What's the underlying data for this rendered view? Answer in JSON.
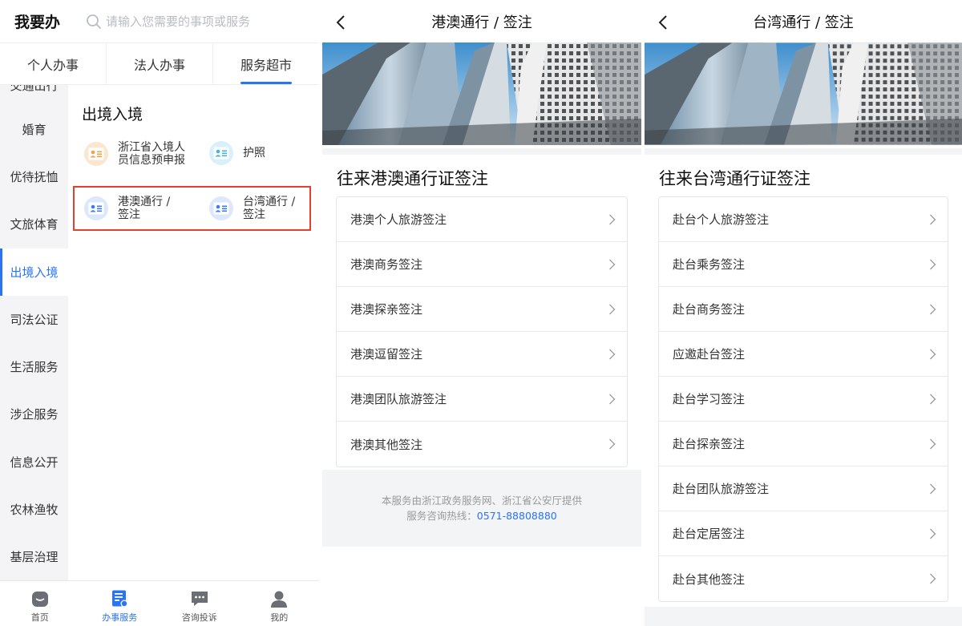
{
  "panel1": {
    "title": "我要办",
    "search": {
      "placeholder": "请输入您需要的事项或服务"
    },
    "tabs": [
      {
        "label": "个人办事"
      },
      {
        "label": "法人办事"
      },
      {
        "label": "服务超市",
        "active": true
      }
    ],
    "sidebar": {
      "cut_item": "交通出行",
      "items": [
        {
          "label": "婚育"
        },
        {
          "label": "优待抚恤"
        },
        {
          "label": "文旅体育"
        },
        {
          "label": "出境入境",
          "active": true
        },
        {
          "label": "司法公证"
        },
        {
          "label": "生活服务"
        },
        {
          "label": "涉企服务"
        },
        {
          "label": "信息公开"
        },
        {
          "label": "农林渔牧"
        },
        {
          "label": "基层治理"
        }
      ]
    },
    "section_title": "出境入境",
    "services": [
      {
        "label_l1": "浙江省入境人",
        "label_l2": "员信息预申报",
        "icon": "id-card-icon",
        "color": "#f0a24a"
      },
      {
        "label_l1": "护照",
        "label_l2": "",
        "icon": "id-card-icon",
        "color": "#3fb6e8"
      },
      {
        "label_l1": "港澳通行 /",
        "label_l2": "签注",
        "icon": "id-card-icon",
        "color": "#3b7df0"
      },
      {
        "label_l1": "台湾通行 /",
        "label_l2": "签注",
        "icon": "id-card-icon",
        "color": "#3b7df0"
      }
    ],
    "bottom_nav": [
      {
        "label": "首页",
        "icon": "home-icon"
      },
      {
        "label": "办事服务",
        "icon": "service-doc-icon",
        "active": true
      },
      {
        "label": "咨询投诉",
        "icon": "chat-bubble-icon"
      },
      {
        "label": "我的",
        "icon": "user-icon"
      }
    ],
    "colors": {
      "accent": "#2b74f0",
      "highlight": "#e2412b"
    }
  },
  "panel2": {
    "title": "港澳通行 / 签注",
    "list_title": "往来港澳通行证签注",
    "items": [
      {
        "label": "港澳个人旅游签注"
      },
      {
        "label": "港澳商务签注"
      },
      {
        "label": "港澳探亲签注"
      },
      {
        "label": "港澳逗留签注"
      },
      {
        "label": "港澳团队旅游签注"
      },
      {
        "label": "港澳其他签注"
      }
    ],
    "footer": {
      "line1": "本服务由浙江政务服务网、浙江省公安厅提供",
      "line2_prefix": "服务咨询热线：",
      "hotline": "0571-88808880"
    }
  },
  "panel3": {
    "title": "台湾通行 / 签注",
    "list_title": "往来台湾通行证签注",
    "items": [
      {
        "label": "赴台个人旅游签注"
      },
      {
        "label": "赴台乘务签注"
      },
      {
        "label": "赴台商务签注"
      },
      {
        "label": "应邀赴台签注"
      },
      {
        "label": "赴台学习签注"
      },
      {
        "label": "赴台探亲签注"
      },
      {
        "label": "赴台团队旅游签注"
      },
      {
        "label": "赴台定居签注"
      },
      {
        "label": "赴台其他签注"
      }
    ]
  }
}
